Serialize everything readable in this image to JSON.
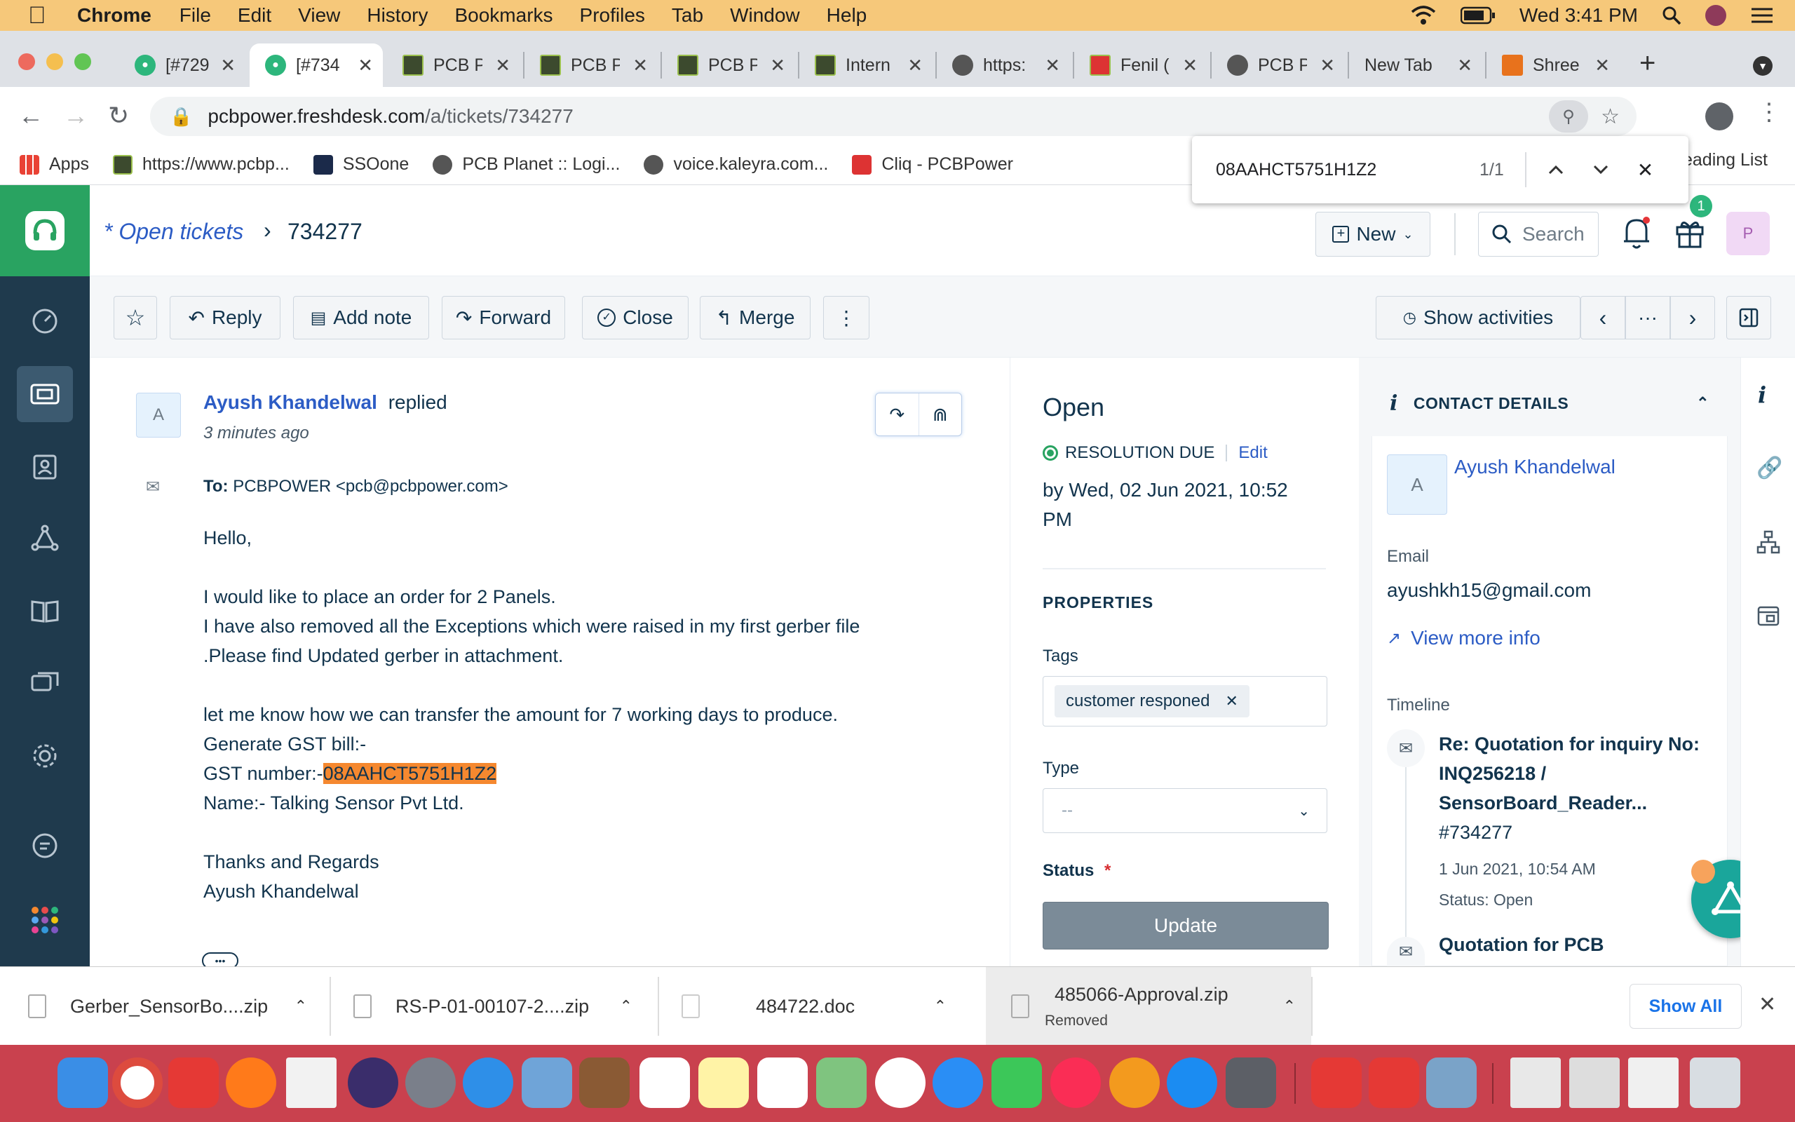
{
  "menubar": {
    "app": "Chrome",
    "items": [
      "File",
      "Edit",
      "View",
      "History",
      "Bookmarks",
      "Profiles",
      "Tab",
      "Window",
      "Help"
    ],
    "clock": "Wed 3:41 PM"
  },
  "tabs": [
    {
      "title": "[#729",
      "icon": "freshdesk-icon"
    },
    {
      "title": "[#734",
      "icon": "freshdesk-icon"
    },
    {
      "title": "PCB P",
      "icon": "pcb-icon"
    },
    {
      "title": "PCB P",
      "icon": "pcb-icon"
    },
    {
      "title": "PCB P",
      "icon": "pcb-icon"
    },
    {
      "title": "Intern",
      "icon": "pcb-icon"
    },
    {
      "title": "https:",
      "icon": "globe-icon"
    },
    {
      "title": "Fenil (",
      "icon": "cliq-icon"
    },
    {
      "title": "PCB P",
      "icon": "globe-icon"
    },
    {
      "title": "New Tab",
      "icon": ""
    },
    {
      "title": "Shree",
      "icon": "shree-icon"
    }
  ],
  "address": {
    "host": "pcbpower.freshdesk.com",
    "path": "/a/tickets/734277"
  },
  "bookmarks": [
    {
      "label": "Apps"
    },
    {
      "label": "https://www.pcbp..."
    },
    {
      "label": "SSOone"
    },
    {
      "label": "PCB Planet :: Logi..."
    },
    {
      "label": "voice.kaleyra.com..."
    },
    {
      "label": "Cliq - PCBPower"
    }
  ],
  "reading_list": "eading List",
  "findbar": {
    "query": "08AAHCT5751H1Z2",
    "count": "1/1"
  },
  "header": {
    "breadcrumb": "* Open tickets",
    "ticket_id": "734277",
    "new_label": "New",
    "search_label": "Search",
    "gift_badge": "1",
    "avatar_initial": "P"
  },
  "actions": {
    "reply": "Reply",
    "add_note": "Add note",
    "forward": "Forward",
    "close": "Close",
    "merge": "Merge",
    "more": "⋮",
    "show_activities": "Show activities",
    "nav_dots": "···"
  },
  "message": {
    "avatar": "A",
    "sender": "Ayush Khandelwal",
    "verb": "replied",
    "time": "3 minutes ago",
    "to_label": "To:",
    "to_value": "PCBPOWER <pcb@pcbpower.com>",
    "lines": [
      "Hello,",
      "",
      "I would like to place an order for 2 Panels.",
      "I have also removed all the Exceptions which were raised in my first gerber file",
      ".Please find Updated gerber in attachment.",
      "",
      "let me know how we can transfer the amount for 7 working days to produce.",
      "Generate GST bill:-"
    ],
    "gst_prefix": "GST number:-",
    "gst_value": "08AAHCT5751H1Z2",
    "name_line": "Name:- Talking Sensor Pvt Ltd.",
    "closing": [
      "Thanks and Regards",
      "Ayush Khandelwal"
    ],
    "ellipsis": "•••"
  },
  "properties": {
    "status_title": "Open",
    "resolution_label": "RESOLUTION DUE",
    "edit_label": "Edit",
    "due_line1": "by Wed, 02 Jun 2021, 10:52",
    "due_line2": "PM",
    "section_title": "PROPERTIES",
    "tags_label": "Tags",
    "tag": "customer responed",
    "type_label": "Type",
    "type_value": "--",
    "status_label": "Status",
    "required_mark": "*",
    "update_label": "Update"
  },
  "contact": {
    "title": "CONTACT DETAILS",
    "avatar": "A",
    "name": "Ayush Khandelwal",
    "email_label": "Email",
    "email": "ayushkh15@gmail.com",
    "view_more": "View more info",
    "timeline_label": "Timeline",
    "timeline": [
      {
        "title_lines": [
          "Re: Quotation for inquiry No:",
          "INQ256218 /",
          "SensorBoard_Reader...",
          "#734277"
        ],
        "date": "1 Jun 2021, 10:54 AM",
        "status": "Status: Open"
      },
      {
        "title_lines": [
          "Quotation for PCB"
        ]
      }
    ]
  },
  "downloads": [
    {
      "name": "Gerber_SensorBo....zip",
      "sub": ""
    },
    {
      "name": "RS-P-01-00107-2....zip",
      "sub": ""
    },
    {
      "name": "484722.doc",
      "sub": ""
    },
    {
      "name": "485066-Approval.zip",
      "sub": "Removed"
    }
  ],
  "show_all": "Show All",
  "colors": {
    "menubar": "#f6c87a",
    "freshdesk_green": "#29a361",
    "sidebar": "#1f3a4d",
    "link_blue": "#2c5cc5",
    "highlight": "#f5882f",
    "dock": "#c9414e"
  }
}
